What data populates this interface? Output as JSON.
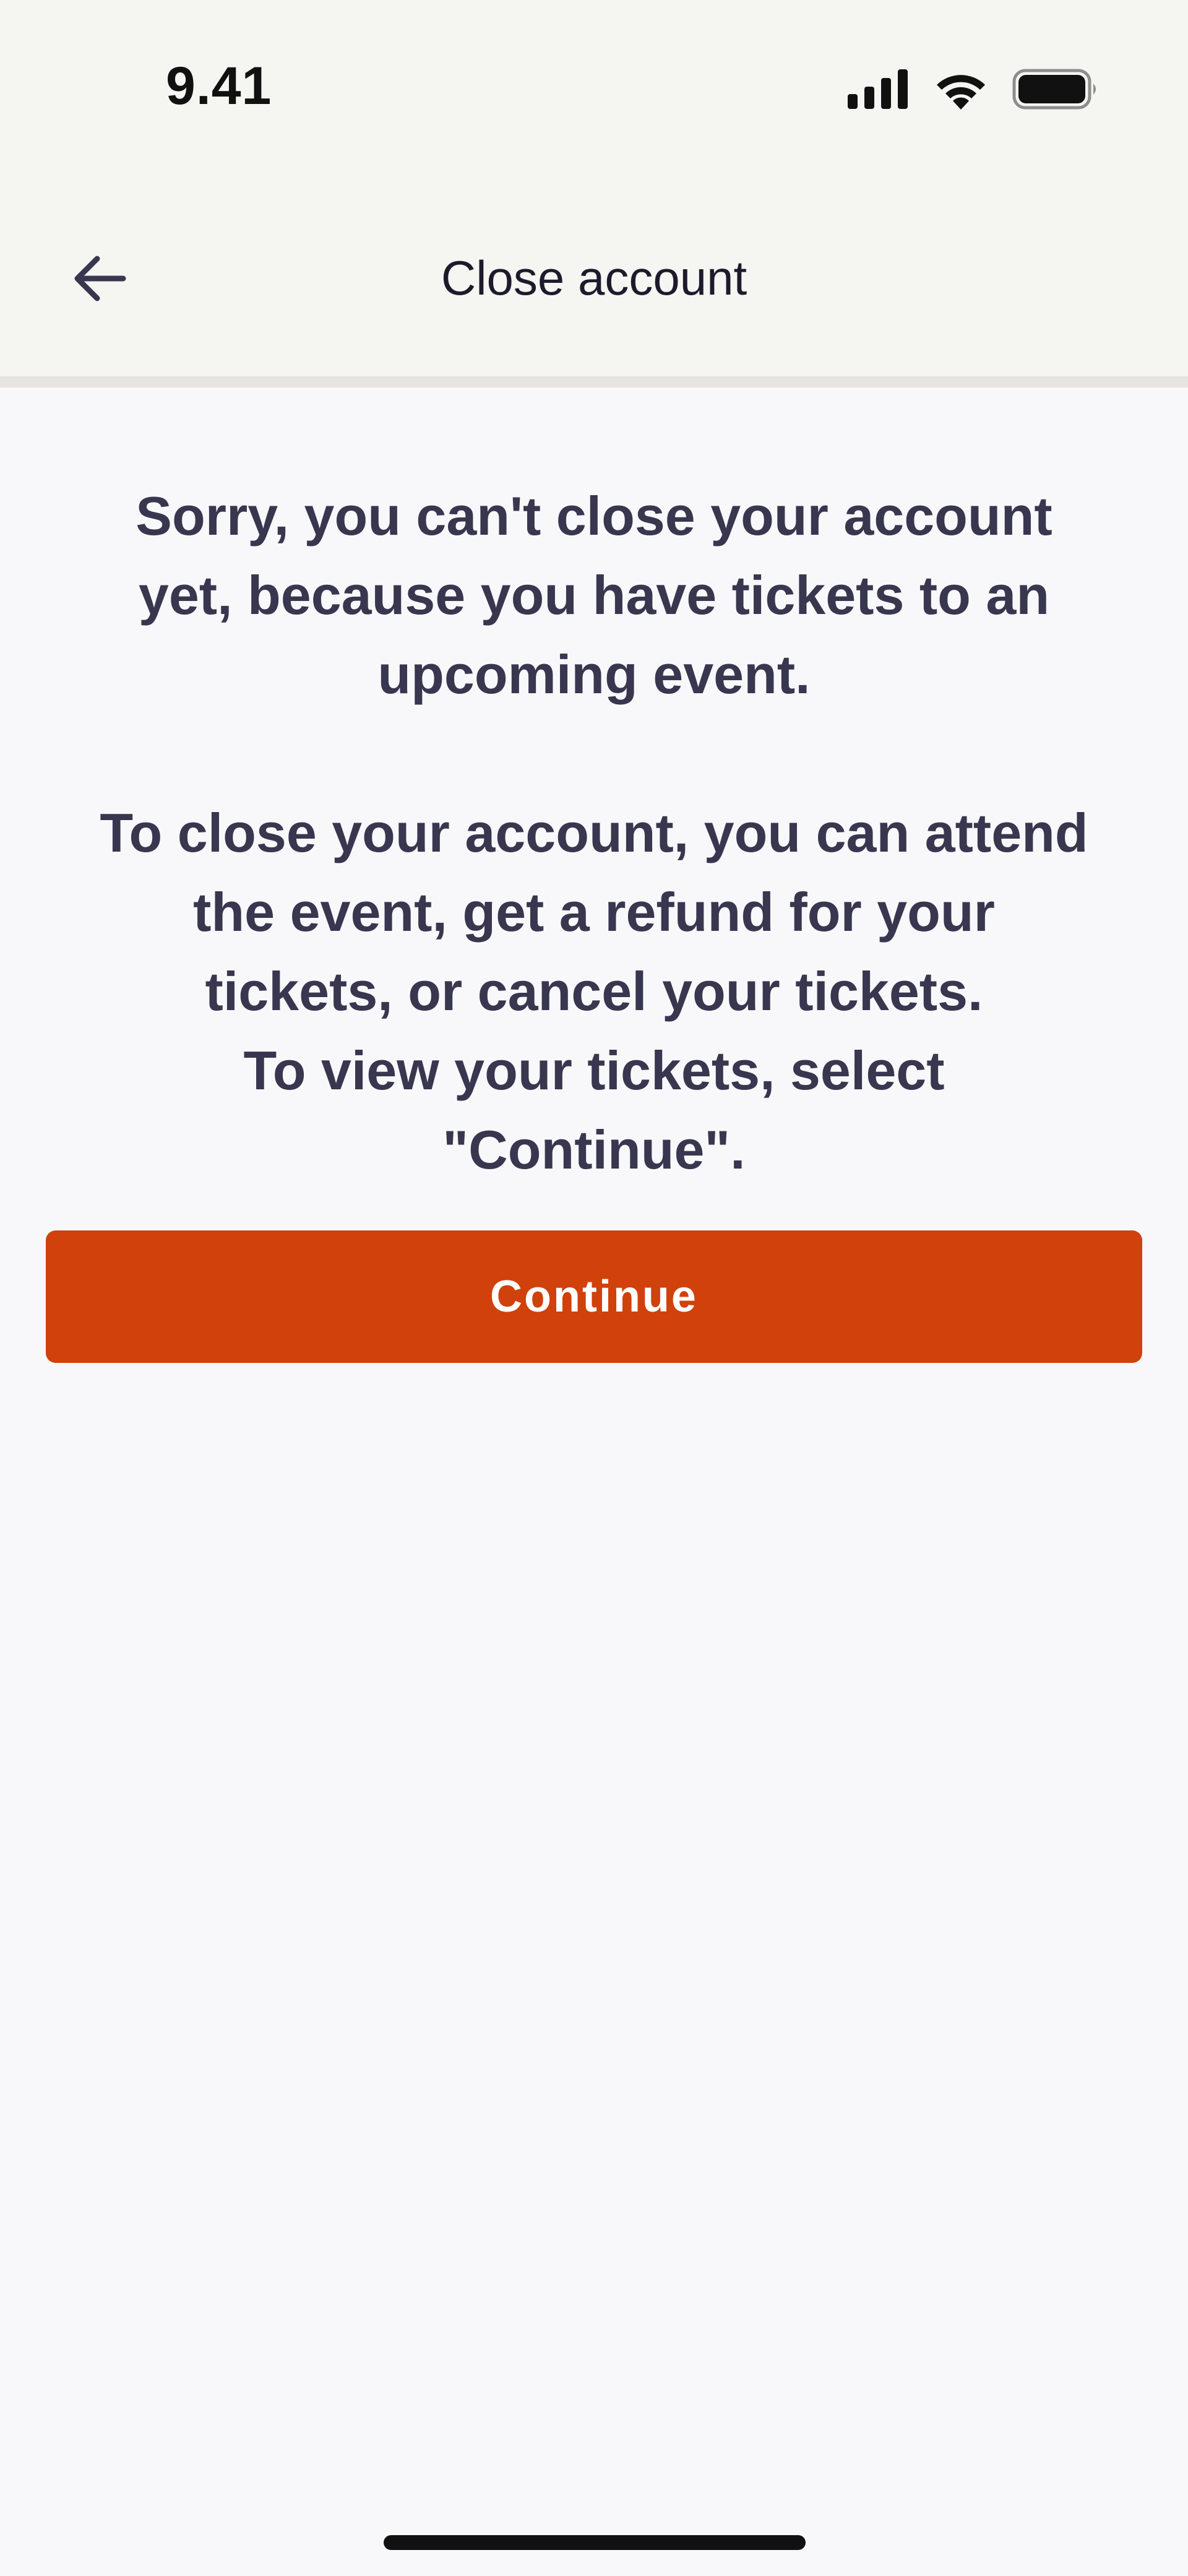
{
  "status_bar": {
    "time": "9.41",
    "icons": [
      "signal-icon",
      "wifi-icon",
      "battery-icon"
    ]
  },
  "nav": {
    "back_icon": "arrow-left-icon",
    "title": "Close account"
  },
  "message": {
    "line1": "Sorry, you can't close your account",
    "line2": "yet, because you have tickets to an",
    "line3": "upcoming event.",
    "line4": "To close your account, you can attend",
    "line5": "the event, get a refund for your",
    "line6": "tickets, or cancel your tickets.",
    "line7": "To view your tickets, select",
    "line8": "\"Continue\"."
  },
  "actions": {
    "continue_label": "Continue"
  },
  "colors": {
    "accent": "#d1410c",
    "text": "#39364f",
    "background": "#f8f8fa",
    "header_background": "#f5f5f1"
  }
}
